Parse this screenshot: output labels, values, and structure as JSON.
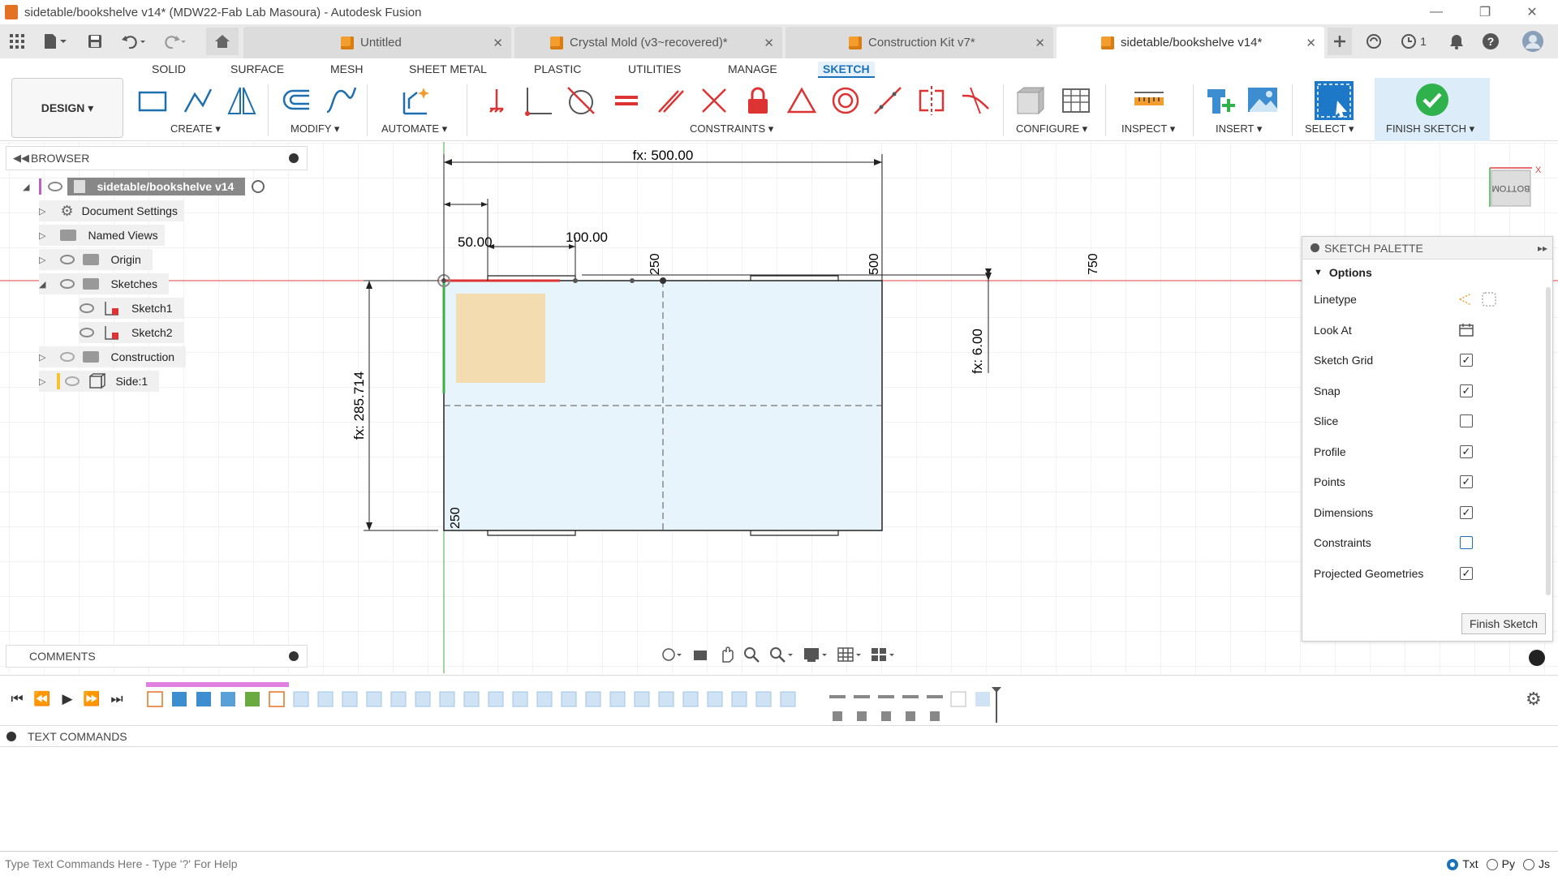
{
  "window": {
    "title": "sidetable/bookshelve v14* (MDW22-Fab Lab Masoura) - Autodesk Fusion"
  },
  "tabs": [
    {
      "label": "Untitled",
      "active": false
    },
    {
      "label": "Crystal Mold (v3~recovered)*",
      "active": false
    },
    {
      "label": "Construction Kit v7*",
      "active": false
    },
    {
      "label": "sidetable/bookshelve v14*",
      "active": true
    }
  ],
  "status": {
    "jobs_count": "1"
  },
  "workspace_tabs": [
    "SOLID",
    "SURFACE",
    "MESH",
    "SHEET METAL",
    "PLASTIC",
    "UTILITIES",
    "MANAGE",
    "SKETCH"
  ],
  "active_workspace_tab": "SKETCH",
  "toolbar": {
    "design_label": "DESIGN ▾",
    "groups": {
      "create": "CREATE ▾",
      "modify": "MODIFY ▾",
      "automate": "AUTOMATE ▾",
      "constraints": "CONSTRAINTS ▾",
      "configure": "CONFIGURE ▾",
      "inspect": "INSPECT ▾",
      "insert": "INSERT ▾",
      "select": "SELECT ▾",
      "finish_sketch": "FINISH SKETCH ▾"
    }
  },
  "browser": {
    "title": "BROWSER",
    "root": "sidetable/bookshelve v14",
    "items": [
      {
        "label": "Document Settings",
        "icon": "gear-icon"
      },
      {
        "label": "Named Views",
        "icon": "folder-icon"
      },
      {
        "label": "Origin",
        "icon": "folder-icon"
      },
      {
        "label": "Sketches",
        "icon": "folder-icon"
      },
      {
        "label": "Sketch1",
        "icon": "sketch-icon"
      },
      {
        "label": "Sketch2",
        "icon": "sketch-icon"
      },
      {
        "label": "Construction",
        "icon": "folder-icon"
      },
      {
        "label": "Side:1",
        "icon": "component-icon"
      }
    ]
  },
  "comments_label": "COMMENTS",
  "sketch": {
    "dims": {
      "width": "fx: 500.00",
      "left_offset": "50.00",
      "slot": "100.00",
      "height": "fx: 285.714",
      "thickness": "fx: 6.00",
      "mark_250_top": "250",
      "mark_500": "500",
      "mark_750": "750",
      "mark_250_bottom": "250"
    }
  },
  "viewcube_label": "BOTTOM",
  "palette": {
    "title": "SKETCH PALETTE",
    "section": "Options",
    "rows": [
      {
        "label": "Linetype",
        "type": "icons"
      },
      {
        "label": "Look At",
        "type": "button"
      },
      {
        "label": "Sketch Grid",
        "checked": true
      },
      {
        "label": "Snap",
        "checked": true
      },
      {
        "label": "Slice",
        "checked": false
      },
      {
        "label": "Profile",
        "checked": true
      },
      {
        "label": "Points",
        "checked": true
      },
      {
        "label": "Dimensions",
        "checked": true
      },
      {
        "label": "Constraints",
        "checked": false
      },
      {
        "label": "Projected Geometries",
        "checked": true
      }
    ],
    "finish_button": "Finish Sketch"
  },
  "text_commands": {
    "title": "TEXT COMMANDS",
    "placeholder": "Type Text Commands Here - Type '?' For Help",
    "modes": [
      "Txt",
      "Py",
      "Js"
    ],
    "selected_mode": "Txt"
  },
  "colors": {
    "accent": "#1a73b8",
    "finish_green": "#2fb24c",
    "sketch_fill": "#e8f4fb",
    "highlight_fill": "#f4d9a6",
    "axis_red": "#e04040",
    "axis_green": "#3cb043"
  }
}
